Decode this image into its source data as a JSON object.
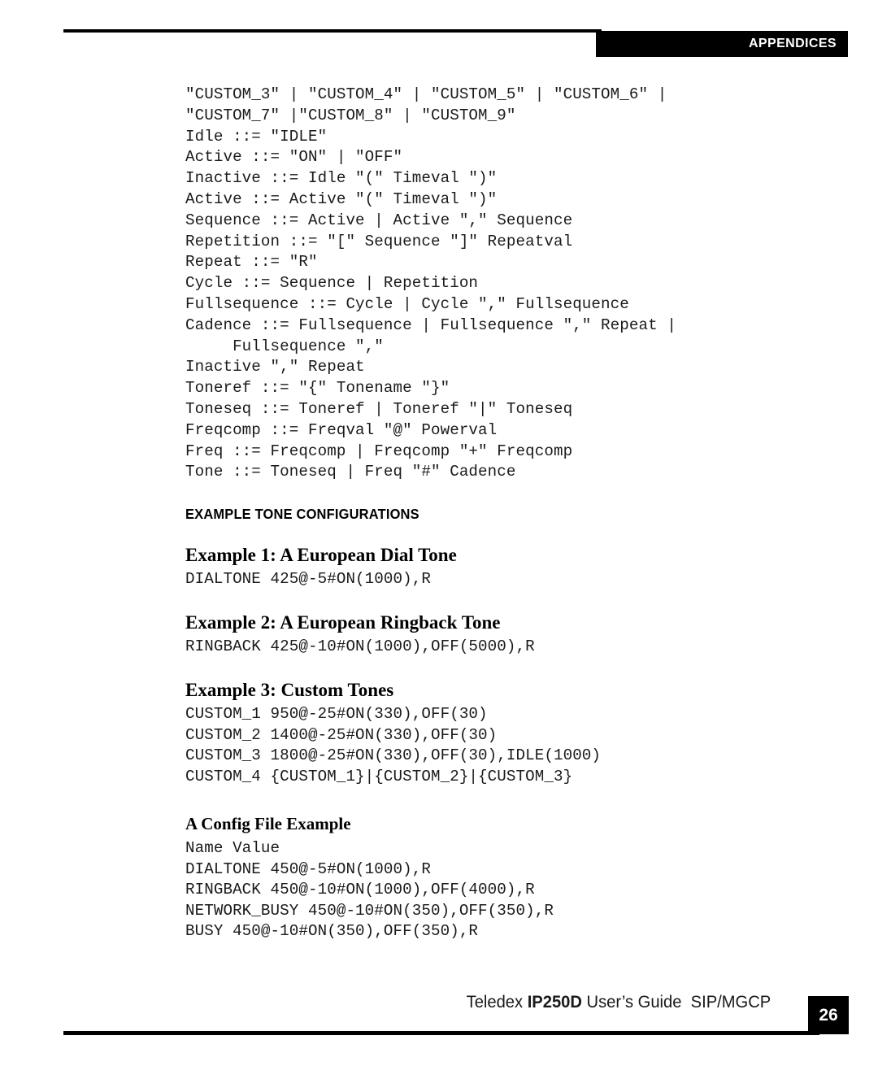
{
  "header": {
    "tab_label": "APPENDICES"
  },
  "main": {
    "grammar_code": "\"CUSTOM_3\" | \"CUSTOM_4\" | \"CUSTOM_5\" | \"CUSTOM_6\" |\n\"CUSTOM_7\" |\"CUSTOM_8\" | \"CUSTOM_9\"\nIdle ::= \"IDLE\"\nActive ::= \"ON\" | \"OFF\"\nInactive ::= Idle \"(\" Timeval \")\"\nActive ::= Active \"(\" Timeval \")\"\nSequence ::= Active | Active \",\" Sequence\nRepetition ::= \"[\" Sequence \"]\" Repeatval\nRepeat ::= \"R\"\nCycle ::= Sequence | Repetition\nFullsequence ::= Cycle | Cycle \",\" Fullsequence\nCadence ::= Fullsequence | Fullsequence \",\" Repeat |\n     Fullsequence \",\"\nInactive \",\" Repeat\nToneref ::= \"{\" Tonename \"}\"\nToneseq ::= Toneref | Toneref \"|\" Toneseq\nFreqcomp ::= Freqval \"@\" Powerval\nFreq ::= Freqcomp | Freqcomp \"+\" Freqcomp\nTone ::= Toneseq | Freq \"#\" Cadence",
    "section_heading": "EXAMPLE TONE CONFIGURATIONS",
    "examples": [
      {
        "heading": "Example 1: A European Dial Tone",
        "code": "DIALTONE 425@-5#ON(1000),R"
      },
      {
        "heading": "Example 2: A European Ringback Tone",
        "code": "RINGBACK 425@-10#ON(1000),OFF(5000),R"
      },
      {
        "heading": "Example 3: Custom Tones",
        "code": "CUSTOM_1 950@-25#ON(330),OFF(30)\nCUSTOM_2 1400@-25#ON(330),OFF(30)\nCUSTOM_3 1800@-25#ON(330),OFF(30),IDLE(1000)\nCUSTOM_4 {CUSTOM_1}|{CUSTOM_2}|{CUSTOM_3}"
      }
    ],
    "config_example": {
      "heading": "A Config File Example",
      "code": "Name Value\nDIALTONE 450@-5#ON(1000),R\nRINGBACK 450@-10#ON(1000),OFF(4000),R\nNETWORK_BUSY 450@-10#ON(350),OFF(350),R\nBUSY 450@-10#ON(350),OFF(350),R"
    }
  },
  "footer": {
    "brand": "Teledex ",
    "model": "IP250D",
    "guide": " User’s Guide  SIP/MGCP",
    "page_number": "26"
  }
}
